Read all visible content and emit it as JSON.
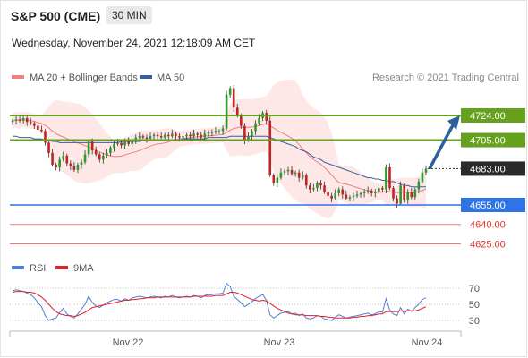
{
  "header": {
    "title": "S&P 500 (CME)",
    "timeframe": "30 MIN",
    "datetime": "Wednesday, November 24, 2021 12:18:09 AM CET"
  },
  "legend": {
    "ma20": "MA 20 + Bollinger Bands",
    "ma50": "MA 50",
    "credit": "Research © 2021 Trading Central"
  },
  "rsi_legend": {
    "rsi": "RSI",
    "ma9": "9MA"
  },
  "colors": {
    "ma20": "#f08080",
    "band_fill": "#fde3e3",
    "ma50": "#3a5e9a",
    "resistance": "#66a11d",
    "support": "#2f74e6",
    "support_red": "#f07a7a",
    "current": "#2a2a2a",
    "arrow": "#2f5e9e",
    "candle_up": "#2a9a2a",
    "candle_down": "#c32222",
    "rsi": "#4f7fd9",
    "rsi_ma": "#e0202a"
  },
  "chart_data": {
    "type": "candlestick",
    "title": "S&P 500 (CME)",
    "timeframe": "30 MIN",
    "ylim": [
      4610,
      4770
    ],
    "x_ticks": [
      "Nov 22",
      "Nov 23",
      "Nov 24"
    ],
    "levels": [
      {
        "label": "4724.00",
        "value": 4724.0,
        "kind": "resistance"
      },
      {
        "label": "4705.00",
        "value": 4705.0,
        "kind": "resistance"
      },
      {
        "label": "4683.00",
        "value": 4683.0,
        "kind": "current"
      },
      {
        "label": "4655.00",
        "value": 4655.0,
        "kind": "support"
      },
      {
        "label": "4640.00",
        "value": 4640.0,
        "kind": "support_red"
      },
      {
        "label": "4625.00",
        "value": 4625.0,
        "kind": "support_red"
      }
    ],
    "arrow": {
      "from_price": 4683,
      "to_price": 4724
    },
    "ohlc_closes": [
      4720,
      4721,
      4720,
      4722,
      4719,
      4718,
      4716,
      4713,
      4712,
      4703,
      4695,
      4686,
      4684,
      4690,
      4693,
      4687,
      4685,
      4682,
      4686,
      4688,
      4694,
      4704,
      4697,
      4694,
      4690,
      4693,
      4695,
      4699,
      4702,
      4703,
      4701,
      4704,
      4702,
      4705,
      4707,
      4708,
      4707,
      4706,
      4708,
      4709,
      4708,
      4707,
      4709,
      4708,
      4710,
      4708,
      4707,
      4708,
      4709,
      4708,
      4710,
      4709,
      4707,
      4710,
      4711,
      4711,
      4712,
      4712,
      4714,
      4740,
      4745,
      4730,
      4724,
      4716,
      4705,
      4708,
      4712,
      4718,
      4722,
      4726,
      4720,
      4678,
      4672,
      4676,
      4680,
      4681,
      4682,
      4679,
      4680,
      4676,
      4678,
      4670,
      4667,
      4668,
      4672,
      4670,
      4665,
      4662,
      4660,
      4664,
      4667,
      4663,
      4660,
      4661,
      4662,
      4663,
      4664,
      4665,
      4666,
      4664,
      4665,
      4668,
      4667,
      4684,
      4668,
      4660,
      4656,
      4670,
      4659,
      4665,
      4661,
      4667,
      4673,
      4680,
      4683
    ],
    "ma50": [
      4708,
      4708,
      4707,
      4707,
      4707,
      4707,
      4706,
      4706,
      4706,
      4705,
      4705,
      4704,
      4704,
      4703,
      4703,
      4703,
      4703,
      4703,
      4703,
      4703,
      4703,
      4703,
      4703,
      4703,
      4703,
      4703,
      4703,
      4703,
      4703,
      4703,
      4704,
      4704,
      4704,
      4704,
      4704,
      4704,
      4705,
      4705,
      4705,
      4705,
      4705,
      4705,
      4705,
      4705,
      4705,
      4705,
      4705,
      4706,
      4706,
      4706,
      4706,
      4706,
      4706,
      4706,
      4707,
      4707,
      4707,
      4707,
      4707,
      4707,
      4708,
      4708,
      4708,
      4708,
      4708,
      4708,
      4708,
      4708,
      4708,
      4708,
      4708,
      4707,
      4706,
      4705,
      4704,
      4703,
      4702,
      4701,
      4700,
      4698,
      4697,
      4696,
      4694,
      4692,
      4691,
      4690,
      4688,
      4687,
      4686,
      4685,
      4684,
      4683,
      4682,
      4681,
      4680,
      4679,
      4678,
      4677,
      4676,
      4676,
      4675,
      4675,
      4674,
      4674,
      4673,
      4673,
      4672,
      4671,
      4670,
      4670,
      4669,
      4669,
      4669,
      4669,
      4669
    ],
    "rsi_ylim": [
      20,
      80
    ],
    "rsi_ticks": [
      70,
      50,
      30
    ],
    "rsi": [
      67,
      68,
      67,
      66,
      64,
      62,
      58,
      52,
      47,
      36,
      30,
      32,
      33,
      40,
      45,
      38,
      35,
      33,
      38,
      44,
      50,
      60,
      52,
      48,
      46,
      49,
      52,
      54,
      56,
      56,
      54,
      57,
      55,
      58,
      59,
      60,
      59,
      58,
      59,
      60,
      59,
      58,
      60,
      59,
      61,
      59,
      58,
      59,
      60,
      59,
      61,
      60,
      58,
      61,
      62,
      62,
      63,
      63,
      64,
      76,
      72,
      60,
      56,
      52,
      47,
      50,
      53,
      57,
      60,
      62,
      55,
      37,
      33,
      36,
      39,
      40,
      41,
      38,
      39,
      36,
      38,
      33,
      32,
      33,
      36,
      35,
      32,
      31,
      30,
      34,
      37,
      35,
      33,
      34,
      35,
      36,
      37,
      38,
      39,
      37,
      38,
      41,
      40,
      57,
      43,
      38,
      36,
      46,
      38,
      44,
      41,
      46,
      50,
      56,
      58
    ],
    "rsi_ma9": [
      65,
      66,
      66,
      66,
      65,
      65,
      64,
      62,
      59,
      55,
      50,
      45,
      41,
      38,
      37,
      36,
      36,
      35,
      36,
      38,
      40,
      43,
      46,
      47,
      48,
      49,
      50,
      51,
      52,
      53,
      54,
      55,
      55,
      56,
      56,
      57,
      57,
      58,
      58,
      58,
      59,
      59,
      59,
      59,
      59,
      59,
      59,
      59,
      59,
      59,
      60,
      60,
      60,
      60,
      60,
      60,
      61,
      61,
      61,
      63,
      65,
      65,
      64,
      62,
      60,
      58,
      56,
      55,
      54,
      55,
      54,
      51,
      48,
      45,
      43,
      41,
      39,
      38,
      37,
      37,
      37,
      36,
      36,
      36,
      36,
      35,
      35,
      34,
      34,
      33,
      33,
      33,
      33,
      33,
      34,
      34,
      35,
      35,
      36,
      36,
      37,
      38,
      38,
      41,
      41,
      41,
      41,
      42,
      41,
      42,
      42,
      42,
      43,
      45,
      47
    ]
  }
}
